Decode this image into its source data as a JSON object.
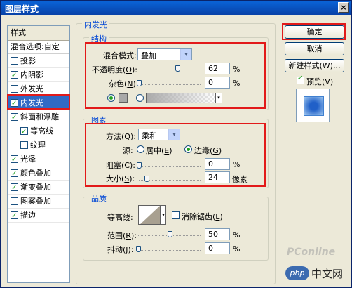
{
  "window": {
    "title": "图层样式",
    "close": "×"
  },
  "style_list": {
    "header": "样式",
    "blend": "混合选项:自定",
    "items": [
      {
        "label": "投影",
        "checked": false
      },
      {
        "label": "内阴影",
        "checked": true
      },
      {
        "label": "外发光",
        "checked": false
      },
      {
        "label": "内发光",
        "checked": true
      },
      {
        "label": "斜面和浮雕",
        "checked": true
      },
      {
        "label": "等高线",
        "checked": true
      },
      {
        "label": "纹理",
        "checked": false
      },
      {
        "label": "光泽",
        "checked": true
      },
      {
        "label": "颜色叠加",
        "checked": true
      },
      {
        "label": "渐变叠加",
        "checked": true
      },
      {
        "label": "图案叠加",
        "checked": false
      },
      {
        "label": "描边",
        "checked": true
      }
    ]
  },
  "panel": {
    "title": "内发光"
  },
  "structure": {
    "title": "结构",
    "blend_mode_label": "混合模式:",
    "blend_mode_value": "叠加",
    "opacity_label": "不透明度(",
    "opacity_key": "O",
    "opacity_label_end": "):",
    "opacity_value": "62",
    "noise_label": "杂色(",
    "noise_key": "N",
    "noise_label_end": "):",
    "noise_value": "0",
    "percent": "%",
    "arrow": "▾"
  },
  "elements": {
    "title": "图素",
    "technique_label": "方法(",
    "technique_key": "Q",
    "technique_label_end": "):",
    "technique_value": "柔和",
    "source_label": "源:",
    "center_label": "居中(",
    "center_key": "E",
    "center_end": ")",
    "edge_label": "边缘(",
    "edge_key": "G",
    "edge_end": ")",
    "choke_label": "阻塞(",
    "choke_key": "C",
    "choke_end": "):",
    "choke_value": "0",
    "size_label": "大小(",
    "size_key": "S",
    "size_end": "):",
    "size_value": "24",
    "size_unit": "像素",
    "percent": "%"
  },
  "quality": {
    "title": "品质",
    "contour_label": "等高线:",
    "antialias_label": "消除锯齿(",
    "antialias_key": "L",
    "antialias_end": ")",
    "range_label": "范围(",
    "range_key": "R",
    "range_end": "):",
    "range_value": "50",
    "jitter_label": "抖动(",
    "jitter_key": "J",
    "jitter_end": "):",
    "jitter_value": "0",
    "percent": "%"
  },
  "buttons": {
    "ok": "确定",
    "cancel": "取消",
    "new_style": "新建样式(W)...",
    "preview_label": "预览(V)",
    "preview_checked": true
  },
  "slider_levels": {
    "opacity": 0.62,
    "noise": 0,
    "choke": 0,
    "size": 0.12,
    "range": 0.5,
    "jitter": 0
  },
  "watermark": {
    "pconline": "PConline",
    "php": "php",
    "cn": "中文网"
  },
  "colors": {
    "glow_color": "#a8a8a8",
    "selection": "#316ac5",
    "highlight_box": "#e21a1a"
  }
}
